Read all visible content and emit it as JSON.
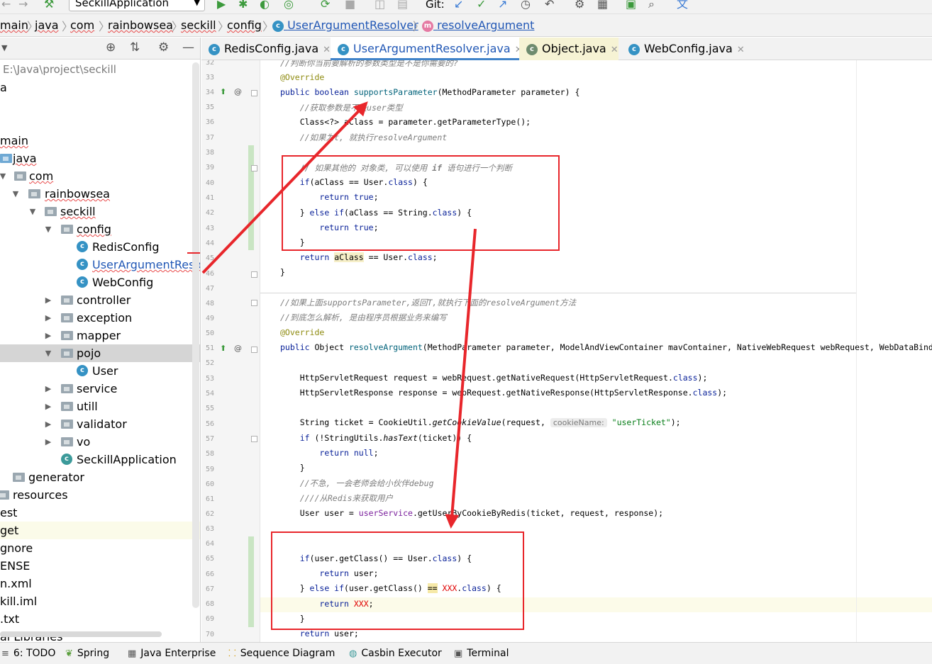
{
  "toolbar": {
    "run_config": "SeckillApplication",
    "git_label": "Git:"
  },
  "breadcrumb": {
    "items": [
      "main",
      "java",
      "com",
      "rainbowsea",
      "seckill",
      "config"
    ],
    "class_name": "UserArgumentResolver",
    "method_name": "resolveArgument"
  },
  "project": {
    "path_label": "E:\\Java\\project\\seckill",
    "rows": [
      {
        "label": "a"
      },
      {
        "label": "main"
      },
      {
        "label": "java"
      },
      {
        "label": "com"
      },
      {
        "label": "rainbowsea"
      },
      {
        "label": "seckill"
      },
      {
        "label": "config"
      },
      {
        "label": "RedisConfig"
      },
      {
        "label": "UserArgumentResolver"
      },
      {
        "label": "WebConfig"
      },
      {
        "label": "controller"
      },
      {
        "label": "exception"
      },
      {
        "label": "mapper"
      },
      {
        "label": "pojo"
      },
      {
        "label": "User"
      },
      {
        "label": "service"
      },
      {
        "label": "utill"
      },
      {
        "label": "validator"
      },
      {
        "label": "vo"
      },
      {
        "label": "SeckillApplication"
      },
      {
        "label": "generator"
      },
      {
        "label": "resources"
      },
      {
        "label": "est"
      },
      {
        "label": "get"
      },
      {
        "label": "gnore"
      },
      {
        "label": "ENSE"
      },
      {
        "label": "n.xml"
      },
      {
        "label": "kill.iml"
      },
      {
        "label": ".txt"
      },
      {
        "label": "al Libraries"
      }
    ]
  },
  "tabs": [
    {
      "label": "RedisConfig.java"
    },
    {
      "label": "UserArgumentResolver.java"
    },
    {
      "label": "Object.java"
    },
    {
      "label": "WebConfig.java"
    }
  ],
  "editor": {
    "line_numbers": [
      "32",
      "33",
      "34",
      "35",
      "36",
      "37",
      "38",
      "39",
      "40",
      "41",
      "42",
      "43",
      "44",
      "45",
      "46",
      "47",
      "48",
      "49",
      "50",
      "51",
      "52",
      "53",
      "54",
      "55",
      "56",
      "57",
      "58",
      "59",
      "60",
      "61",
      "62",
      "63",
      "64",
      "65",
      "66",
      "67",
      "68",
      "69",
      "70"
    ],
    "hint_cookie_name": "cookieName:",
    "annotation_color": "#e8262b"
  },
  "statusbar": {
    "items": [
      "6: TODO",
      "Spring",
      "Java Enterprise",
      "Sequence Diagram",
      "Casbin Executor",
      "Terminal"
    ]
  }
}
